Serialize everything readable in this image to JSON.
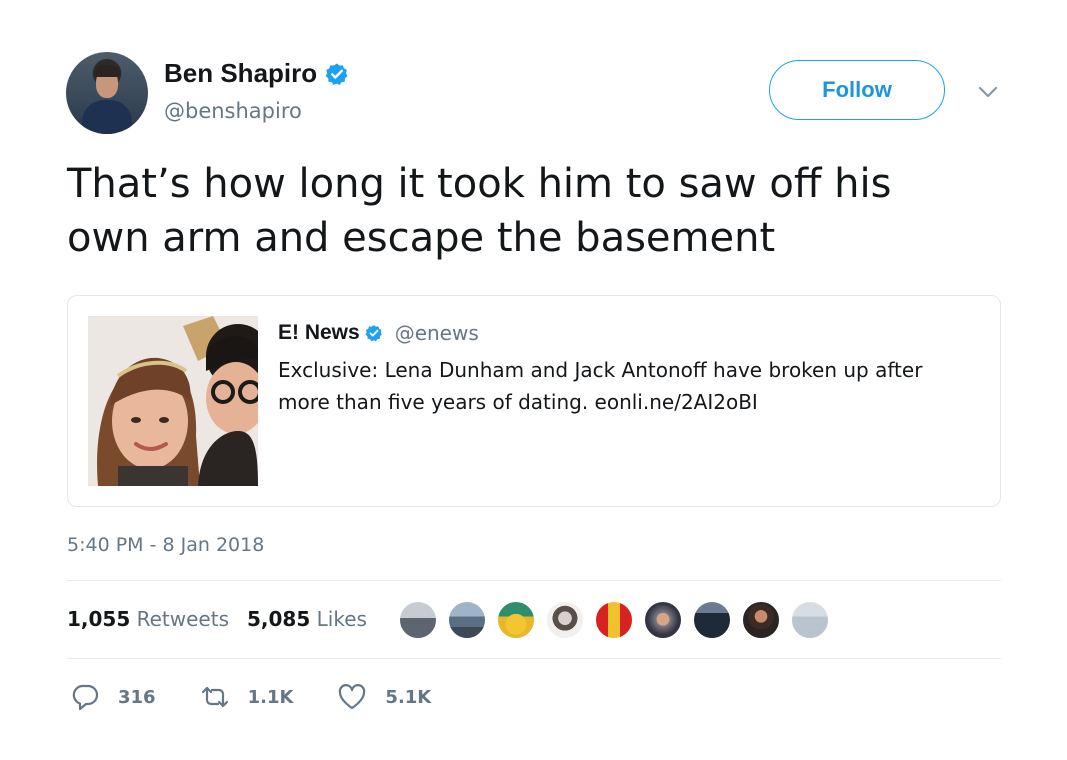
{
  "author": {
    "display_name": "Ben Shapiro",
    "handle": "@benshapiro"
  },
  "follow_label": "Follow",
  "tweet_text": "That’s how long it took him to saw off his own arm and escape the basement",
  "quoted_tweet": {
    "name": "E! News",
    "handle": "@enews",
    "text": "Exclusive: Lena Dunham and Jack Antonoff have broken up after more than five years of dating. eonli.ne/2AI2oBI"
  },
  "timestamp": "5:40 PM - 8 Jan 2018",
  "stats": {
    "retweets_count": "1,055",
    "retweets_label": "Retweets",
    "likes_count": "5,085",
    "likes_label": "Likes"
  },
  "actions": {
    "reply_count": "316",
    "retweet_count": "1.1K",
    "like_count": "5.1K"
  },
  "icons": {
    "verified": "verified-badge-icon",
    "caret": "chevron-down-icon",
    "reply": "reply-icon",
    "retweet": "retweet-icon",
    "like": "heart-icon"
  },
  "colors": {
    "brand_blue": "#1da1f2",
    "follow_text": "#1b95e0",
    "secondary_text": "#657786",
    "primary_text": "#14171a",
    "border": "#e1e8ed"
  }
}
